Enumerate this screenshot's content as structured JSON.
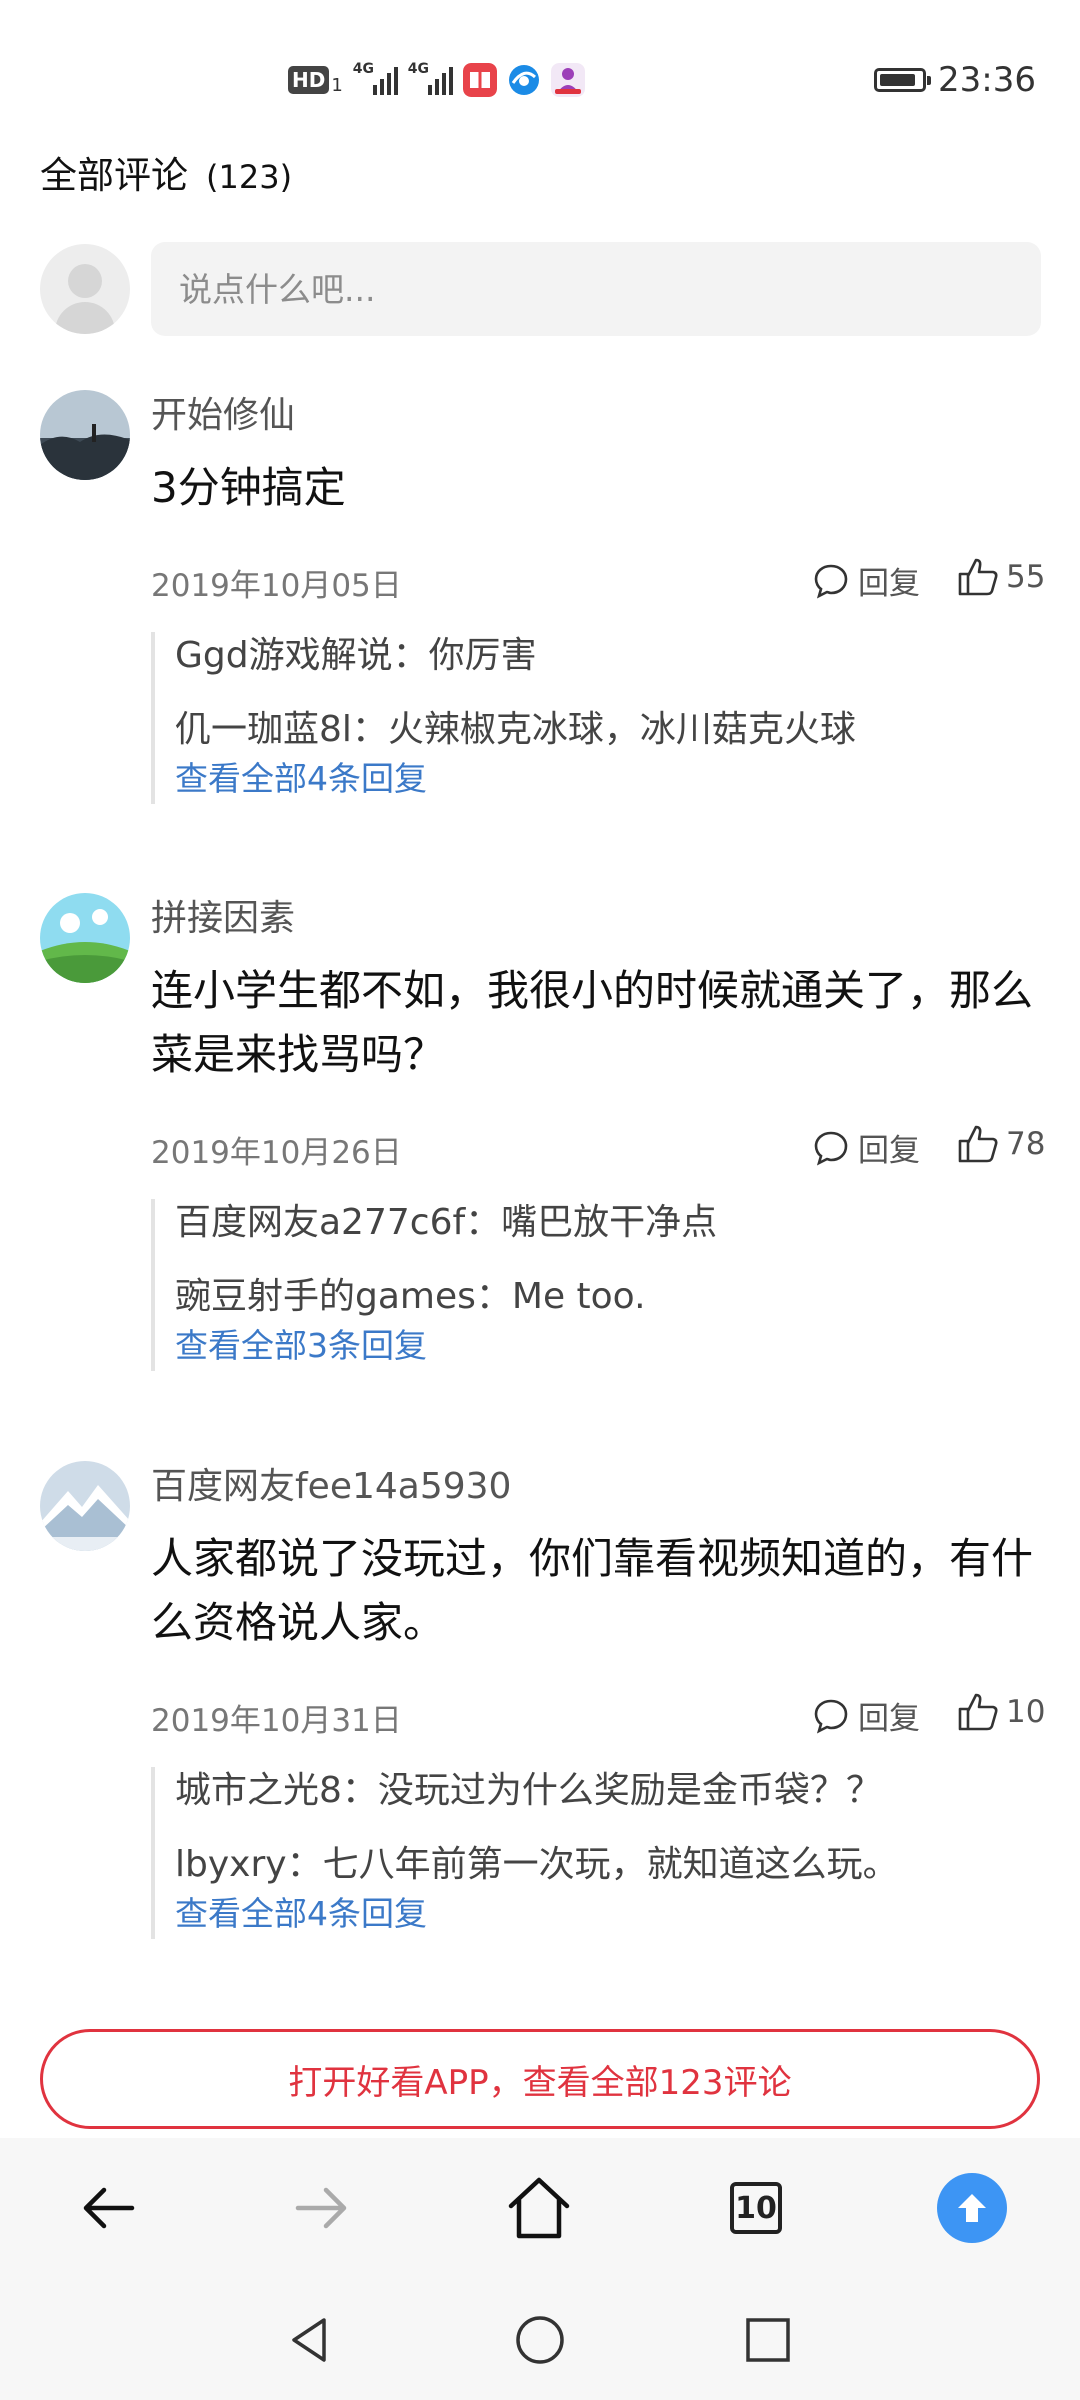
{
  "status_bar": {
    "network_badge": "HD",
    "network_sub": "1",
    "signal_1_label": "4G",
    "signal_2_label": "4G",
    "time": "23:36",
    "battery_level": 0.9
  },
  "comments": {
    "title": "全部评论",
    "count_label": "(123)",
    "input_placeholder": "说点什么吧...",
    "reply_label": "回复",
    "items": [
      {
        "user": "开始修仙",
        "text": "3分钟搞定",
        "date": "2019年10月05日",
        "likes": "55",
        "replies": [
          "Ggd游戏解说：你厉害",
          "仉一珈蓝8l：火辣椒克冰球，冰川菇克火球"
        ],
        "view_all": "查看全部4条回复"
      },
      {
        "user": "拼接因素",
        "text": "连小学生都不如，我很小的时候就通关了，那么菜是来找骂吗？",
        "date": "2019年10月26日",
        "likes": "78",
        "replies": [
          "百度网友a277c6f：嘴巴放干净点",
          "豌豆射手的games：Me too."
        ],
        "view_all": "查看全部3条回复"
      },
      {
        "user": "百度网友fee14a5930",
        "text": "人家都说了没玩过，你们靠看视频知道的，有什么资格说人家。",
        "date": "2019年10月31日",
        "likes": "10",
        "replies": [
          "城市之光8：没玩过为什么奖励是金币袋？？",
          "lbyxry：七八年前第一次玩，就知道这么玩。"
        ],
        "view_all": "查看全部4条回复"
      }
    ]
  },
  "open_app_button": "打开好看APP，查看全部123评论",
  "toolbar": {
    "tab_count": "10",
    "accent_color": "#3d95f4"
  },
  "colors": {
    "link": "#3b79c8",
    "cta_red": "#e0333f"
  }
}
